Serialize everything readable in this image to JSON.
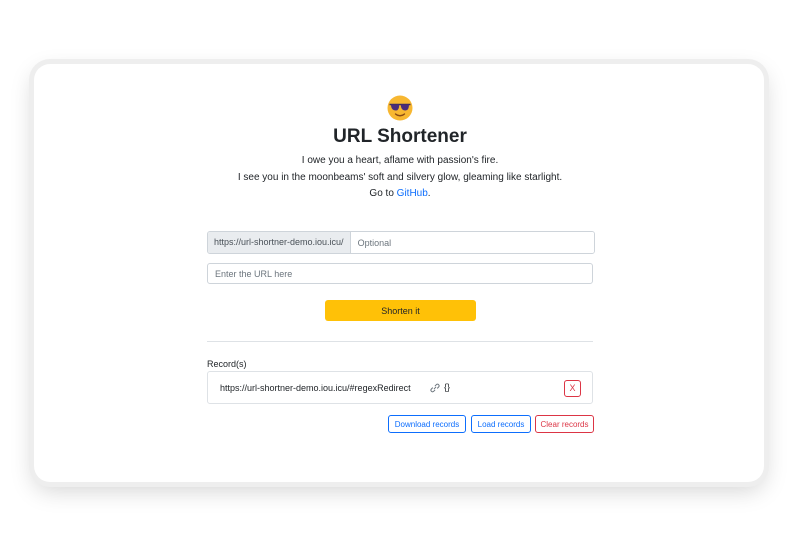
{
  "header": {
    "logo_icon": "sunglasses-face-icon",
    "title": "URL Shortener",
    "lines": [
      "I owe you a heart, aflame with passion's fire.",
      "I see you in the moonbeams' soft and silvery glow, gleaming like starlight."
    ],
    "goto_prefix": "Go to ",
    "github_link": "GitHub",
    "goto_suffix": "."
  },
  "form": {
    "prefix": "https://url-shortner-demo.iou.icu/",
    "suffix_placeholder": "Optional",
    "url_placeholder": "Enter the URL here",
    "shorten_label": "Shorten it"
  },
  "records": {
    "label": "Record(s)",
    "items": [
      {
        "url": "https://url-shortner-demo.iou.icu/#regexRedirect",
        "link_icon": "link-icon",
        "badge": "{}",
        "delete_label": "X"
      }
    ],
    "download_label": "Download records",
    "load_label": "Load records",
    "clear_label": "Clear records"
  },
  "colors": {
    "accent_yellow": "#ffc107",
    "link_blue": "#0d6efd",
    "danger_red": "#dc3545"
  }
}
